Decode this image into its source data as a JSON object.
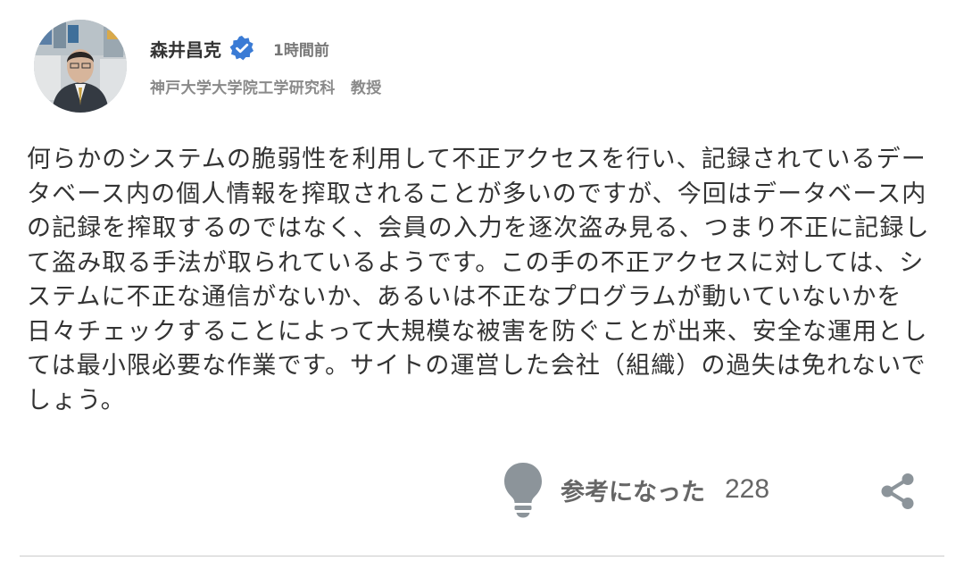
{
  "author": {
    "name": "森井昌克",
    "time": "1時間前",
    "title": "神戸大学大学院工学研究科　教授"
  },
  "comment": {
    "text": "何らかのシステムの脆弱性を利用して不正アクセスを行い、記録されているデータベース内の個人情報を搾取されることが多いのですが、今回はデータベース内の記録を搾取するのではなく、会員の入力を逐次盗み見る、つまり不正に記録して盗み取る手法が取られているようです。この手の不正アクセスに対しては、システムに不正な通信がないか、あるいは不正なプログラムが動いていないかを日々チェックすることによって大規模な被害を防ぐことが出来、安全な運用としては最小限必要な作業です。サイトの運営した会社（組織）の過失は免れないでしょう。"
  },
  "reaction": {
    "label": "参考になった",
    "count": "228"
  },
  "icons": {
    "verified": "verified-badge-icon",
    "lightbulb": "lightbulb-icon",
    "share": "share-icon"
  },
  "colors": {
    "verified_badge": "#3a7bd5",
    "icon_gray": "#8c949a"
  }
}
